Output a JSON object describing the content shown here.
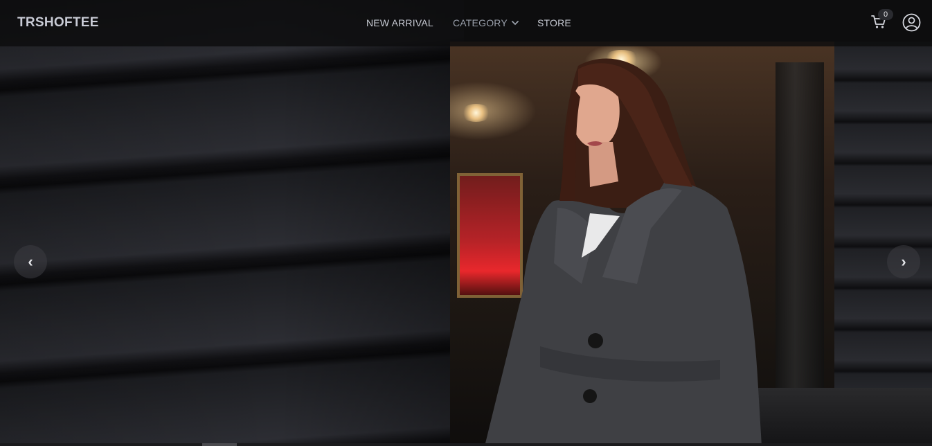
{
  "header": {
    "brand": "TRSHOFTEE",
    "nav": [
      {
        "label": "NEW ARRIVAL"
      },
      {
        "label": "CATEGORY",
        "has_dropdown": true
      },
      {
        "label": "STORE"
      }
    ],
    "cart_count": "0",
    "icons": {
      "cart": "cart-icon",
      "account": "user-circle-icon",
      "dropdown": "chevron-down-icon"
    }
  },
  "carousel": {
    "prev_label": "‹",
    "next_label": "›",
    "slide_count": 1,
    "active_slide": 1
  },
  "colors": {
    "header_bg": "#0c0c0e",
    "nav_text": "#c7cad3",
    "brand_text": "#c9ccd6"
  }
}
